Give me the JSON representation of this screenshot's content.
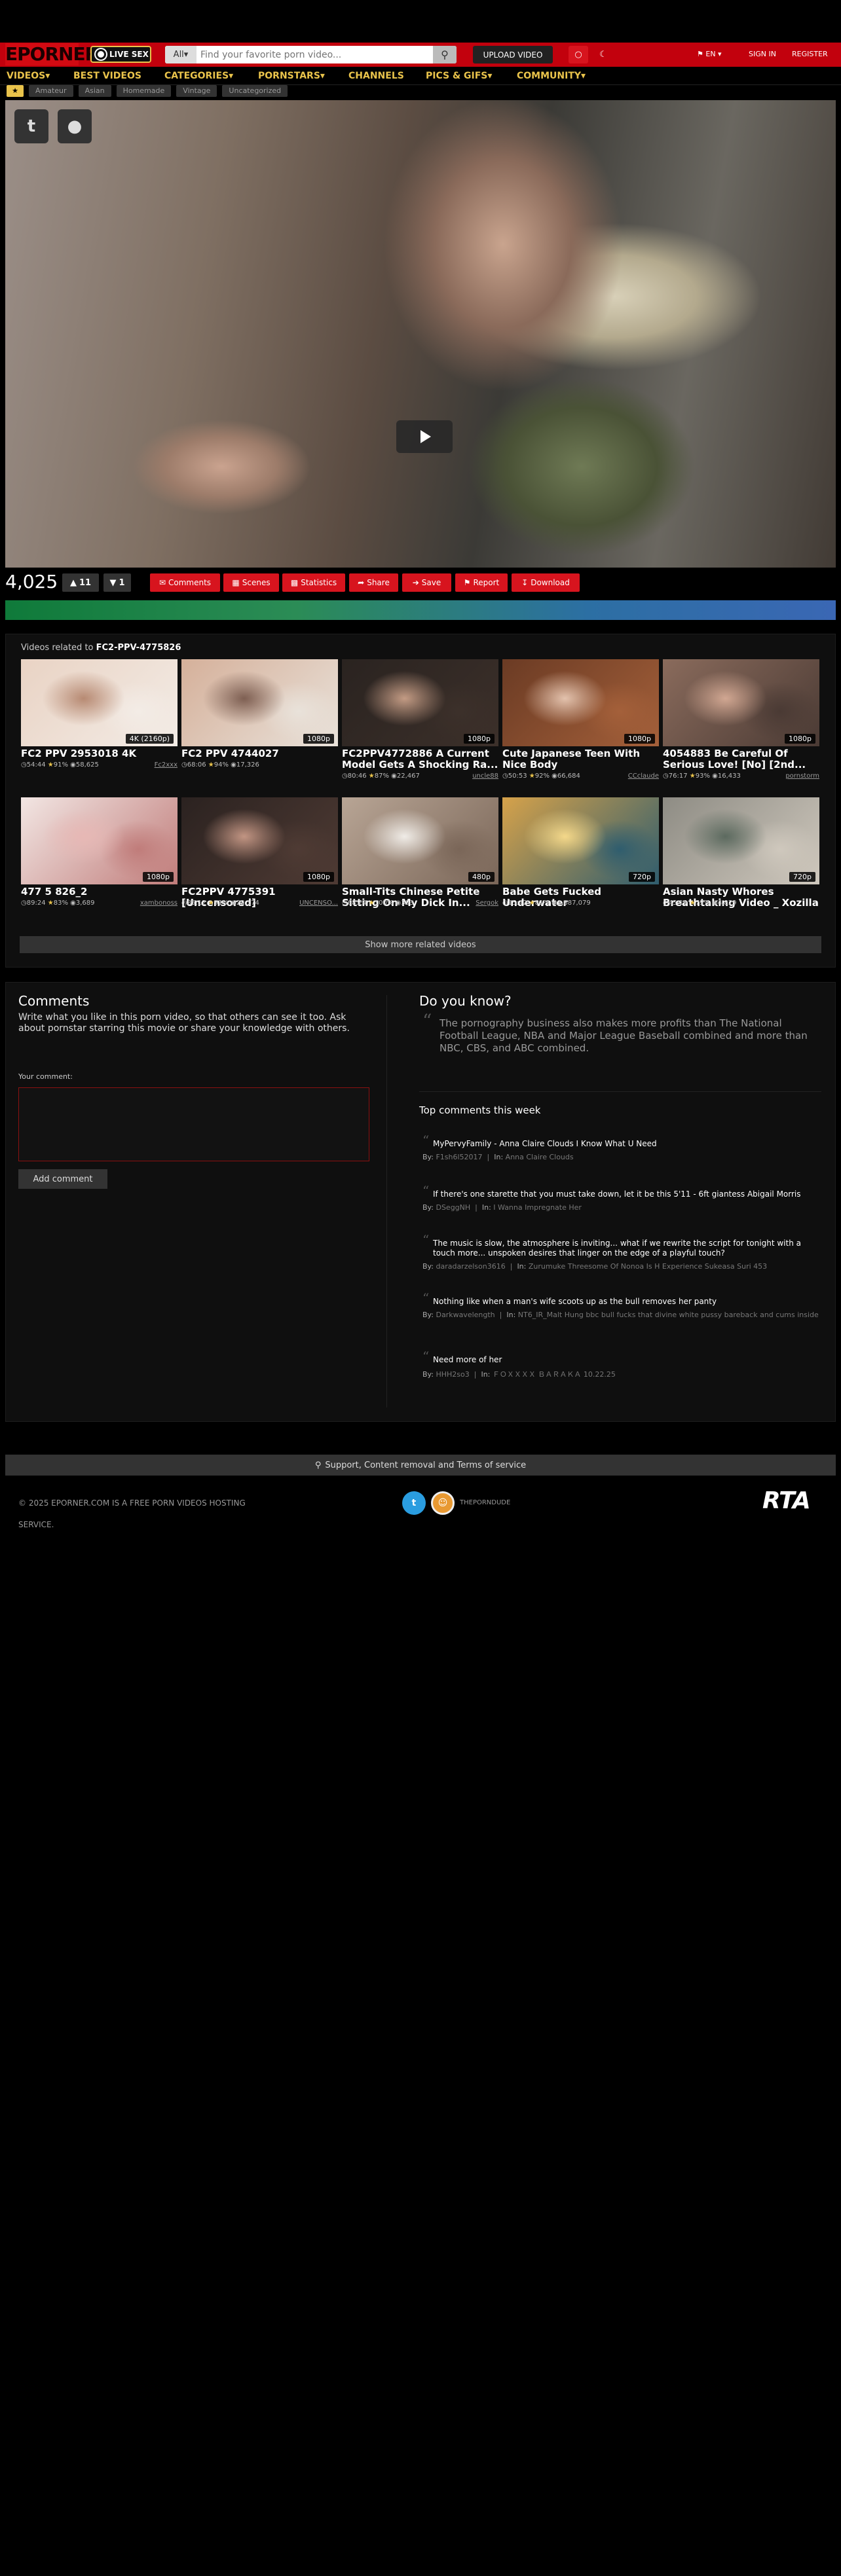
{
  "header": {
    "logo": "EPORNER",
    "live_sex": "LIVE SEX",
    "search_scope": "All",
    "search_placeholder": "Find your favorite porn video...",
    "upload": "UPLOAD VIDEO",
    "language": "EN",
    "signin": "SIGN IN",
    "register": "REGISTER"
  },
  "nav": [
    "VIDEOS",
    "BEST VIDEOS",
    "CATEGORIES",
    "PORNSTARS",
    "CHANNELS",
    "PICS & GIFS",
    "COMMUNITY"
  ],
  "tags": [
    "Amateur",
    "Asian",
    "Homemade",
    "Vintage",
    "Uncategorized"
  ],
  "video": {
    "views": "4,025",
    "likes": "11",
    "dislikes": "1",
    "actions": [
      "Comments",
      "Scenes",
      "Statistics",
      "Share",
      "Save",
      "Report",
      "Download"
    ]
  },
  "related": {
    "title_prefix": "Videos related to",
    "title_code": "FC2-PPV-4775826",
    "show_more": "Show more related videos",
    "items": [
      {
        "title": "FC2 PPV 2953018 4K",
        "quality": "4K (2160p)",
        "duration": "54:44",
        "rating": "91%",
        "views": "58,625",
        "uploader": "Fc2xxx",
        "colors": [
          "#e9d3c4",
          "#b78a73",
          "#f3ece6"
        ]
      },
      {
        "title": "FC2 PPV 4744027",
        "quality": "1080p",
        "duration": "68:06",
        "rating": "94%",
        "views": "17,326",
        "uploader": "",
        "colors": [
          "#d5b09a",
          "#7e5f52",
          "#e9e2da"
        ]
      },
      {
        "title": "FC2PPV4772886 A Current Model Gets A Shocking Ra...",
        "quality": "1080p",
        "duration": "80:46",
        "rating": "87%",
        "views": "22,467",
        "uploader": "uncle88",
        "colors": [
          "#2a2320",
          "#c39b84",
          "#3c302a"
        ]
      },
      {
        "title": "Cute Japanese Teen With Nice Body",
        "quality": "1080p",
        "duration": "50:53",
        "rating": "92%",
        "views": "66,684",
        "uploader": "CCclaude",
        "colors": [
          "#6b3b24",
          "#e3c2ad",
          "#a4603a"
        ]
      },
      {
        "title": "4054883 Be Careful Of Serious Love! [No] [2nd...",
        "quality": "1080p",
        "duration": "76:17",
        "rating": "93%",
        "views": "16,433",
        "uploader": "pornstorm",
        "colors": [
          "#8a6b5c",
          "#d1a792",
          "#4a3a34"
        ]
      },
      {
        "title": "477 5 826_2",
        "quality": "1080p",
        "duration": "89:24",
        "rating": "83%",
        "views": "3,689",
        "uploader": "xambonoss",
        "colors": [
          "#f2e6e3",
          "#e7b8b5",
          "#c07c7a"
        ]
      },
      {
        "title": "FC2PPV 4775391 [Uncensored]",
        "quality": "1080p",
        "duration": "85:12",
        "rating": "91%",
        "views": "22,174",
        "uploader": "UNCENSO...",
        "colors": [
          "#2b2220",
          "#c29583",
          "#4f3b34"
        ]
      },
      {
        "title": "Small-Tits Chinese Petite Sitting On My Dick In...",
        "quality": "480p",
        "duration": "68:24",
        "rating": "100%",
        "views": "303",
        "uploader": "Sergok",
        "colors": [
          "#b8a595",
          "#f0ece7",
          "#7a6658"
        ]
      },
      {
        "title": "Babe Gets Fucked Underwater",
        "quality": "720p",
        "duration": "15:42",
        "rating": "81%",
        "views": "1,887,079",
        "uploader": "",
        "colors": [
          "#d6a24a",
          "#f4d88a",
          "#2f5d6e"
        ]
      },
      {
        "title": "Asian Nasty Whores Breathtaking Video _ Xozilla",
        "quality": "720p",
        "duration": "45:19",
        "rating": "79%",
        "views": "4,829",
        "uploader": "",
        "colors": [
          "#8e8c84",
          "#5c6a5f",
          "#cfc8bd"
        ]
      }
    ]
  },
  "comments": {
    "title": "Comments",
    "intro": "Write what you like in this porn video, so that others can see it too. Ask about pornstar starring this movie or share your knowledge with others.",
    "label": "Your comment:",
    "add": "Add comment"
  },
  "know": {
    "title": "Do you know?",
    "fact": "The pornography business also makes more profits than The National Football League, NBA and Major League Baseball combined and more than NBC, CBS, and ABC combined.",
    "top_title": "Top comments this week",
    "by_label": "By:",
    "in_label": "In:",
    "items": [
      {
        "text": "MyPervyFamily - Anna Claire Clouds I Know What U Need",
        "by": "F1sh6l52017",
        "in": "Anna Claire Clouds"
      },
      {
        "text": "If there's one starette that you must take down, let it be this 5'11 - 6ft giantess Abigail Morris",
        "by": "DSeggNH",
        "in": "I Wanna Impregnate Her"
      },
      {
        "text": "The music is slow, the atmosphere is inviting... what if we rewrite the script for tonight with a touch more... unspoken desires that linger on the edge of a playful touch?",
        "by": "daradarzelson3616",
        "in": "Zurumuke Threesome Of Nonoa Is H Experience Sukeasa Suri 453"
      },
      {
        "text": "Nothing like when a man's wife scoots up as the bull removes her panty",
        "by": "Darkwavelength",
        "in": "NT6_IR_Malt Hung bbc bull fucks that divine white pussy bareback and cums inside"
      },
      {
        "text": "Need more of her",
        "by": "HHH2so3",
        "in": "ＦＯＸＸＸＸ ＢＡＲＡＫＡ 10.22.25"
      }
    ]
  },
  "footer": {
    "support": "Support, Content removal and Terms of service",
    "copyright": "© 2025 EPORNER.COM IS A FREE PORN VIDEOS HOSTING SERVICE.",
    "twitter": "t",
    "partner": "THEPORNDUDE",
    "rta": "RTA"
  }
}
